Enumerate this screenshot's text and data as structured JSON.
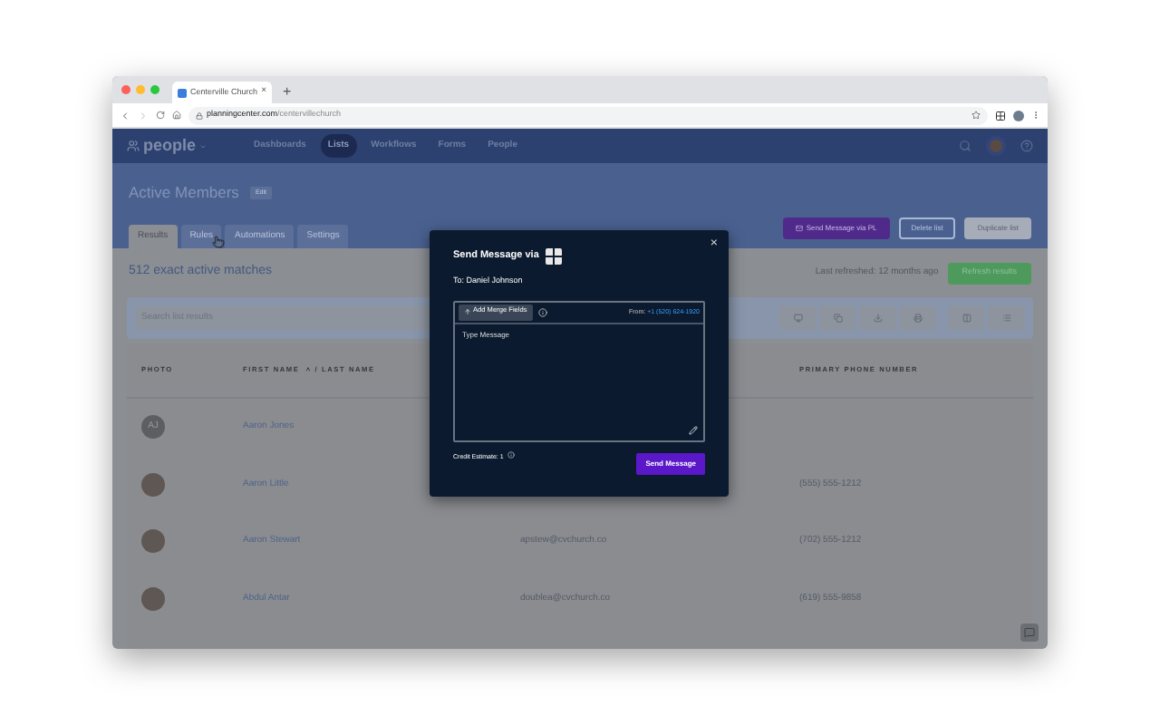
{
  "browser": {
    "tab_title": "Centerville Church",
    "tab_close": "×",
    "new_tab": "+",
    "url_host": "planningcenter.com",
    "url_path": "/centervillechurch"
  },
  "app_header": {
    "logo": "people",
    "nav": [
      {
        "label": "Dashboards",
        "selected": false
      },
      {
        "label": "Lists",
        "selected": true
      },
      {
        "label": "Workflows",
        "selected": false
      },
      {
        "label": "Forms",
        "selected": false
      },
      {
        "label": "People",
        "selected": false
      }
    ]
  },
  "list": {
    "title": "Active Members",
    "edit": "Edit",
    "actions": [
      {
        "label": "Send Message via PL",
        "kind": "primary"
      },
      {
        "label": "Delete list",
        "kind": "outline"
      },
      {
        "label": "Duplicate list",
        "kind": "light"
      }
    ],
    "tabs": [
      {
        "label": "Results",
        "selected": true
      },
      {
        "label": "Rules",
        "selected": false
      },
      {
        "label": "Automations",
        "selected": false
      },
      {
        "label": "Settings",
        "selected": false
      }
    ]
  },
  "results": {
    "count": "512 exact active matches",
    "last_refreshed": "Last refreshed: 12 months ago",
    "refresh": "Refresh results",
    "search": {
      "placeholder": "Search list results"
    }
  },
  "table": {
    "columns": [
      "PHOTO",
      "FIRST NAME  ˄ / LAST NAME",
      "PRIMARY PHONE NUMBER"
    ],
    "rows": [
      {
        "initials": "AJ",
        "name": "Aaron Jones",
        "email": "",
        "phone": ""
      },
      {
        "name": "Aaron Little",
        "email": "",
        "phone": "(555) 555-1212"
      },
      {
        "name": "Aaron Stewart",
        "email": "apstew@cvchurch.co",
        "phone": "(702) 555-1212"
      },
      {
        "name": "Abdul Antar",
        "email": "doublea@cvchurch.co",
        "phone": "(619) 555-9858"
      }
    ]
  },
  "modal": {
    "title": "Send Message via",
    "close": "×",
    "to": "To: Daniel Johnson",
    "merge": "Add Merge Fields",
    "from_label": "From:",
    "from_number": "+1 (520) 624-1920",
    "placeholder": "Type Message",
    "credit": "Credit Estimate: 1",
    "send": "Send Message"
  }
}
